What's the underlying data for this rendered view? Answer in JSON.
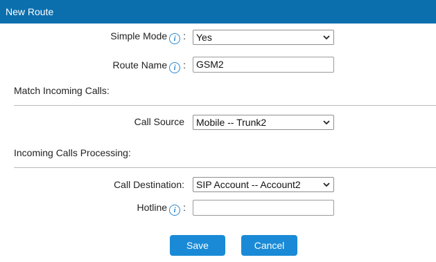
{
  "window": {
    "title": "New Route"
  },
  "form": {
    "simple_mode": {
      "label": "Simple Mode",
      "colon": ":",
      "value": "Yes"
    },
    "route_name": {
      "label": "Route Name",
      "colon": ":",
      "value": "GSM2"
    },
    "match_section": {
      "title": "Match Incoming Calls:"
    },
    "call_source": {
      "label": "Call Source",
      "value": "Mobile -- Trunk2"
    },
    "processing_section": {
      "title": "Incoming Calls Processing:"
    },
    "call_destination": {
      "label": "Call Destination:",
      "value": "SIP Account -- Account2"
    },
    "hotline": {
      "label": "Hotline",
      "colon": ":",
      "value": ""
    }
  },
  "buttons": {
    "save": "Save",
    "cancel": "Cancel"
  },
  "icons": {
    "info": "info-icon",
    "dropdown": "chevron-down-icon"
  },
  "colors": {
    "title_bar": "#0b6fae",
    "button": "#1a8ad6",
    "info_icon": "#2a86d0"
  }
}
